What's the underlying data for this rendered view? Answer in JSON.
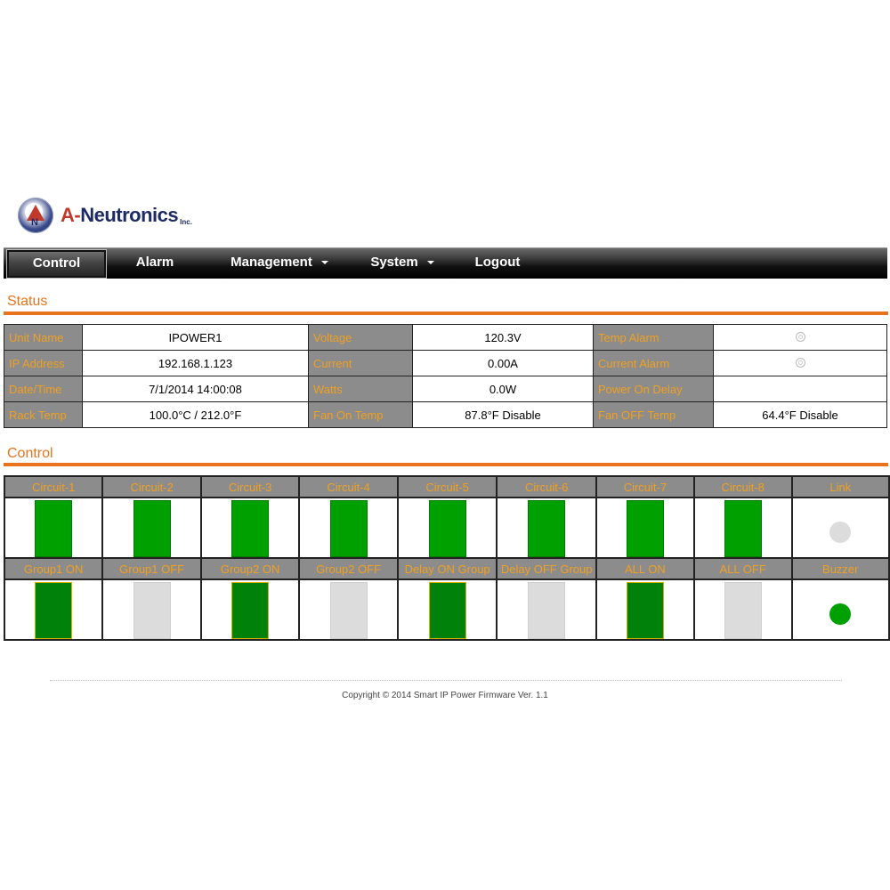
{
  "brand": {
    "name_first": "A-",
    "name_rest": "Neutronics",
    "suffix": "Inc.",
    "mark_letters": "A N",
    "registered": "®"
  },
  "nav": {
    "items": [
      {
        "label": "Control",
        "active": true,
        "dropdown": false
      },
      {
        "label": "Alarm",
        "active": false,
        "dropdown": false
      },
      {
        "label": "Management",
        "active": false,
        "dropdown": true
      },
      {
        "label": "System",
        "active": false,
        "dropdown": true
      },
      {
        "label": "Logout",
        "active": false,
        "dropdown": false
      }
    ]
  },
  "status": {
    "title": "Status",
    "rows": [
      [
        {
          "label": "Unit Name",
          "value": "IPOWER1"
        },
        {
          "label": "Voltage",
          "value": "120.3V"
        },
        {
          "label": "Temp Alarm",
          "value": "",
          "icon": "led-off-icon"
        }
      ],
      [
        {
          "label": "IP Address",
          "value": "192.168.1.123"
        },
        {
          "label": "Current",
          "value": "0.00A"
        },
        {
          "label": "Current Alarm",
          "value": "",
          "icon": "led-off-icon"
        }
      ],
      [
        {
          "label": "Date/Time",
          "value": "7/1/2014 14:00:08"
        },
        {
          "label": "Watts",
          "value": "0.0W"
        },
        {
          "label": "Power On Delay",
          "value": ""
        }
      ],
      [
        {
          "label": "Rack Temp",
          "value": "100.0°C  / 212.0°F"
        },
        {
          "label": "Fan On Temp",
          "value": "87.8°F Disable"
        },
        {
          "label": "Fan OFF Temp",
          "value": "64.4°F Disable"
        }
      ]
    ]
  },
  "control": {
    "title": "Control",
    "row1": [
      {
        "label": "Circuit-1",
        "state": "on"
      },
      {
        "label": "Circuit-2",
        "state": "on"
      },
      {
        "label": "Circuit-3",
        "state": "on"
      },
      {
        "label": "Circuit-4",
        "state": "on"
      },
      {
        "label": "Circuit-5",
        "state": "on"
      },
      {
        "label": "Circuit-6",
        "state": "on"
      },
      {
        "label": "Circuit-7",
        "state": "on"
      },
      {
        "label": "Circuit-8",
        "state": "on"
      },
      {
        "label": "Link",
        "state": "indicator-off"
      }
    ],
    "row2": [
      {
        "label": "Group1 ON",
        "state": "grp-on"
      },
      {
        "label": "Group1 OFF",
        "state": "off"
      },
      {
        "label": "Group2 ON",
        "state": "grp-on"
      },
      {
        "label": "Group2 OFF",
        "state": "off"
      },
      {
        "label": "Delay ON Group",
        "state": "grp-on"
      },
      {
        "label": "Delay OFF Group",
        "state": "off"
      },
      {
        "label": "ALL ON",
        "state": "grp-on"
      },
      {
        "label": "ALL OFF",
        "state": "off"
      },
      {
        "label": "Buzzer",
        "state": "indicator-on"
      }
    ]
  },
  "colors": {
    "accent": "#e8731c",
    "label_text": "#f0a020",
    "label_bg": "#8c8c8c",
    "switch_on": "#00a000",
    "switch_off": "#dcdcdc",
    "link_off": "#dcdcdc",
    "buzzer_on": "#00a000"
  },
  "footer": {
    "copyright": "Copyright © 2014 Smart IP Power Firmware Ver. 1.1"
  }
}
